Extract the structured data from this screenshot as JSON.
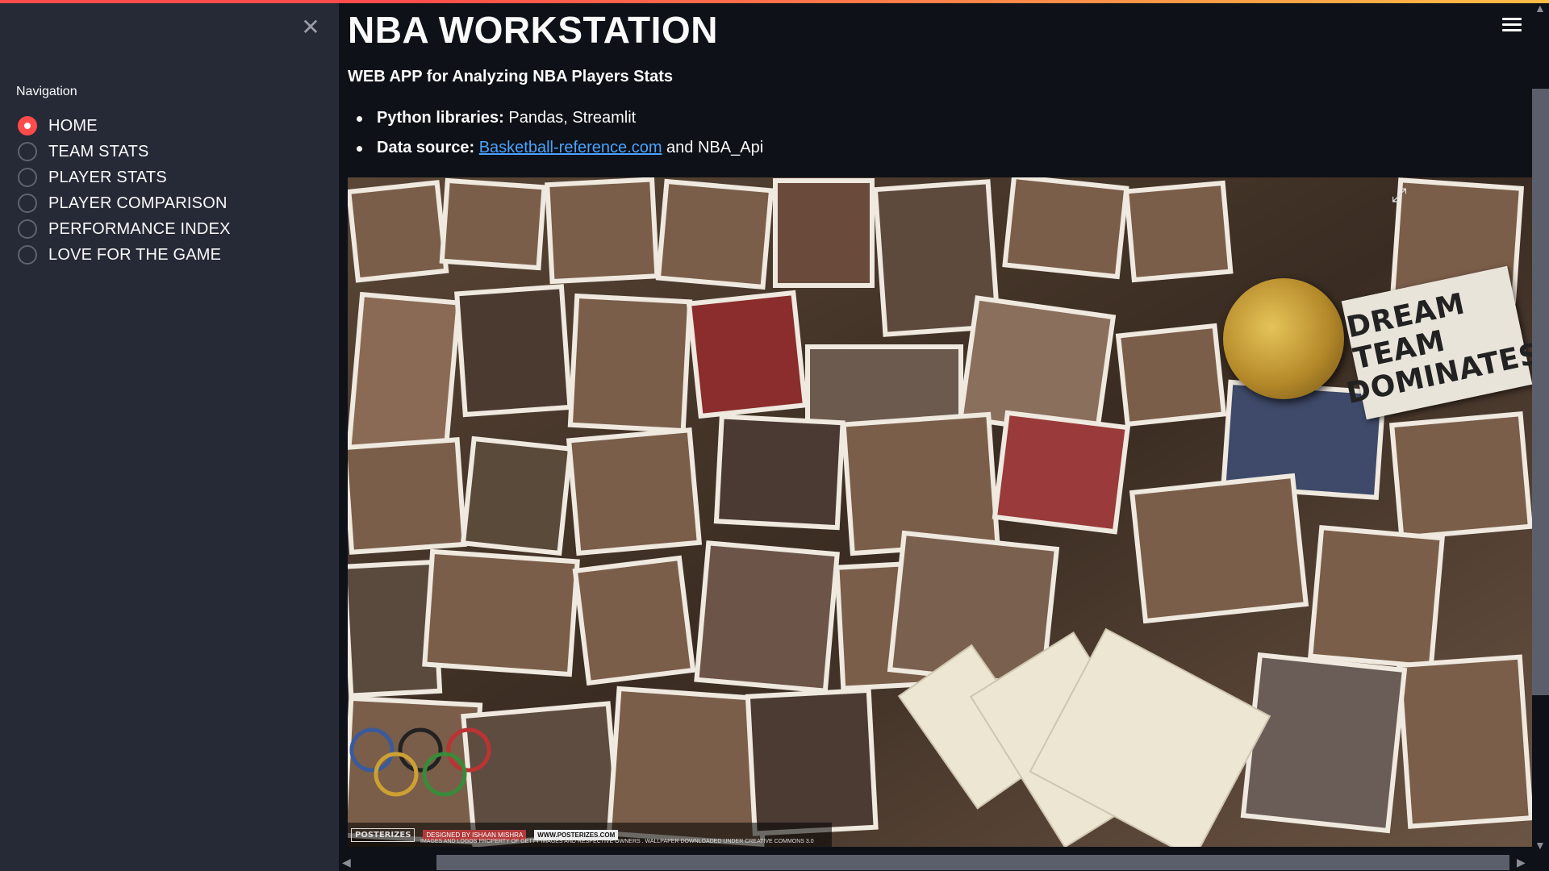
{
  "sidebar": {
    "close_icon": "✕",
    "nav_label": "Navigation",
    "items": [
      {
        "label": "HOME",
        "selected": true
      },
      {
        "label": "TEAM STATS",
        "selected": false
      },
      {
        "label": "PLAYER STATS",
        "selected": false
      },
      {
        "label": "PLAYER COMPARISON",
        "selected": false
      },
      {
        "label": "PERFORMANCE INDEX",
        "selected": false
      },
      {
        "label": "LOVE FOR THE GAME",
        "selected": false
      }
    ]
  },
  "main": {
    "title": "NBA WORKSTATION",
    "subtitle": "WEB APP for Analyzing NBA Players Stats",
    "bullets": [
      {
        "bold": "Python libraries:",
        "text": " Pandas, Streamlit"
      },
      {
        "bold": "Data source:",
        "link": "Basketball-reference.com",
        "text": " and NBA_Api"
      }
    ],
    "image": {
      "card_text_line1": "DREAM TEAM",
      "card_text_line2": "DOMINATES",
      "watermark_logo": "POSTERIZES",
      "watermark_tag": "DESIGNED BY ISHAAN MISHRA",
      "watermark_url": "WWW.POSTERIZES.COM",
      "watermark_note": "IMAGES AND LOGOS PROPERTY OF GETTY IMAGES AND RESPECTIVE OWNERS . WALLPAPER DOWNLOADED UNDER CREATIVE COMMONS 3.0"
    }
  },
  "colors": {
    "accent": "#ff4b4b",
    "sidebar_bg": "#262a36",
    "main_bg": "#0e1117",
    "link": "#4aa3ff"
  },
  "icons": {
    "close": "close-icon",
    "menu": "hamburger-menu-icon",
    "expand": "fullscreen-expand-icon"
  }
}
